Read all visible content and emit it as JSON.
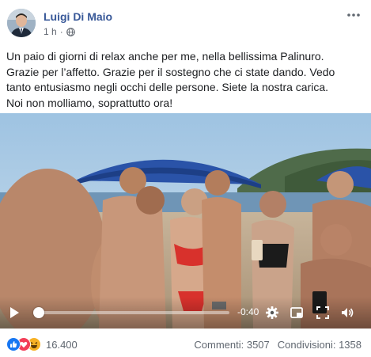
{
  "post": {
    "author": "Luigi Di Maio",
    "time": "1 h",
    "privacy_icon": "globe-icon",
    "caption_lines": [
      "Un paio di giorni di relax anche per me, nella bellissima Palinuro.",
      "Grazie per l’affetto. Grazie per il sostegno che ci state dando. Vedo",
      "tanto entusiasmo negli occhi delle persone. Siete la nostra carica.",
      "Noi non molliamo, soprattutto ora!"
    ]
  },
  "video": {
    "progress_fraction": 0.02,
    "time_remaining": "-0:40",
    "icons": [
      "play-icon",
      "settings-icon",
      "picture-in-picture-icon",
      "fullscreen-icon",
      "volume-icon"
    ]
  },
  "footer": {
    "reactions": [
      "like",
      "love",
      "haha"
    ],
    "reaction_count": "16.400",
    "comments": "Commenti: 3507",
    "shares": "Condivisioni: 1358"
  },
  "colors": {
    "author": "#385898",
    "meta": "#616770",
    "like": "#1877f2",
    "love": "#f33e58",
    "haha": "#f7b125"
  }
}
